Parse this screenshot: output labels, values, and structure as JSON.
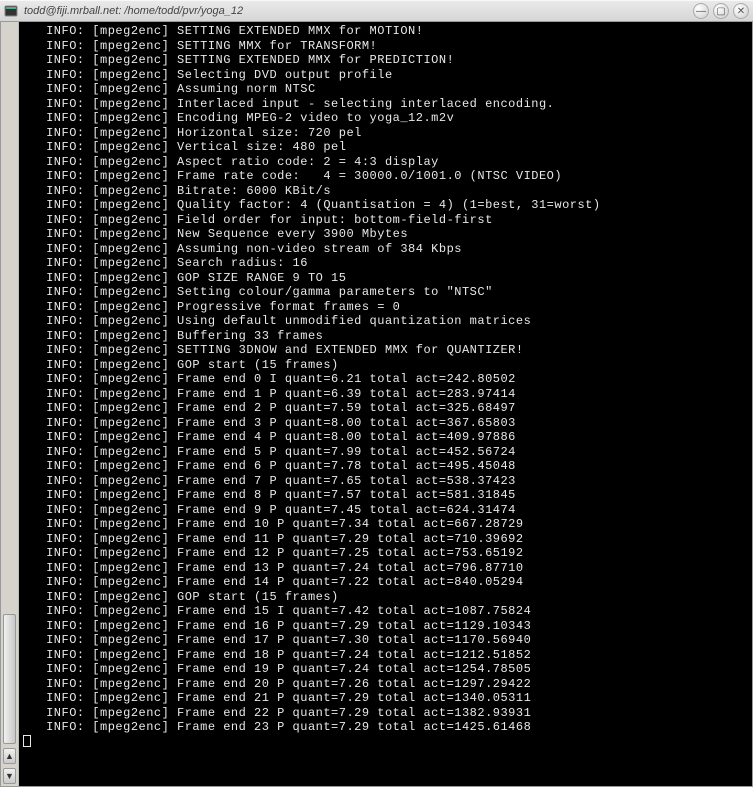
{
  "window": {
    "title": "todd@fiji.mrball.net: /home/todd/pvr/yoga_12",
    "buttons": {
      "min": "—",
      "max": "▢",
      "close": "✕"
    },
    "scroll": {
      "up": "▲",
      "down": "▼"
    }
  },
  "prefix": "   INFO: [mpeg2enc] ",
  "lines": [
    "SETTING EXTENDED MMX for MOTION!",
    "SETTING MMX for TRANSFORM!",
    "SETTING EXTENDED MMX for PREDICTION!",
    "Selecting DVD output profile",
    "Assuming norm NTSC",
    "Interlaced input - selecting interlaced encoding.",
    "Encoding MPEG-2 video to yoga_12.m2v",
    "Horizontal size: 720 pel",
    "Vertical size: 480 pel",
    "Aspect ratio code: 2 = 4:3 display",
    "Frame rate code:   4 = 30000.0/1001.0 (NTSC VIDEO)",
    "Bitrate: 6000 KBit/s",
    "Quality factor: 4 (Quantisation = 4) (1=best, 31=worst)",
    "Field order for input: bottom-field-first",
    "New Sequence every 3900 Mbytes",
    "Assuming non-video stream of 384 Kbps",
    "Search radius: 16",
    "GOP SIZE RANGE 9 TO 15",
    "Setting colour/gamma parameters to \"NTSC\"",
    "Progressive format frames = 0",
    "Using default unmodified quantization matrices",
    "Buffering 33 frames",
    "SETTING 3DNOW and EXTENDED MMX for QUANTIZER!",
    "GOP start (15 frames)",
    "Frame end 0 I quant=6.21 total act=242.80502",
    "Frame end 1 P quant=6.39 total act=283.97414",
    "Frame end 2 P quant=7.59 total act=325.68497",
    "Frame end 3 P quant=8.00 total act=367.65803",
    "Frame end 4 P quant=8.00 total act=409.97886",
    "Frame end 5 P quant=7.99 total act=452.56724",
    "Frame end 6 P quant=7.78 total act=495.45048",
    "Frame end 7 P quant=7.65 total act=538.37423",
    "Frame end 8 P quant=7.57 total act=581.31845",
    "Frame end 9 P quant=7.45 total act=624.31474",
    "Frame end 10 P quant=7.34 total act=667.28729",
    "Frame end 11 P quant=7.29 total act=710.39692",
    "Frame end 12 P quant=7.25 total act=753.65192",
    "Frame end 13 P quant=7.24 total act=796.87710",
    "Frame end 14 P quant=7.22 total act=840.05294",
    "GOP start (15 frames)",
    "Frame end 15 I quant=7.42 total act=1087.75824",
    "Frame end 16 P quant=7.29 total act=1129.10343",
    "Frame end 17 P quant=7.30 total act=1170.56940",
    "Frame end 18 P quant=7.24 total act=1212.51852",
    "Frame end 19 P quant=7.24 total act=1254.78505",
    "Frame end 20 P quant=7.26 total act=1297.29422",
    "Frame end 21 P quant=7.29 total act=1340.05311",
    "Frame end 22 P quant=7.29 total act=1382.93931",
    "Frame end 23 P quant=7.29 total act=1425.61468"
  ]
}
